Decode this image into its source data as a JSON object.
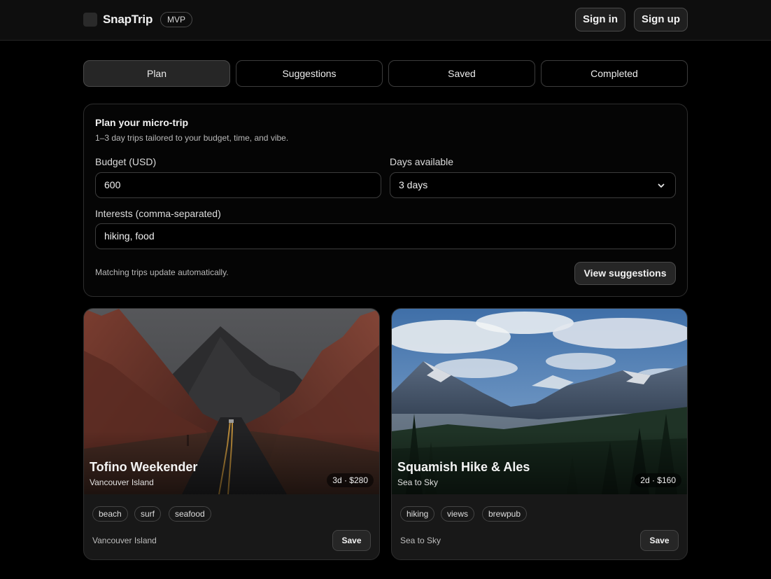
{
  "header": {
    "brand": "SnapTrip",
    "badge": "MVP",
    "signin_label": "Sign in",
    "signup_label": "Sign up",
    "logo_icon": "logo-square-icon"
  },
  "tabs": [
    {
      "label": "Plan",
      "active": true
    },
    {
      "label": "Suggestions",
      "active": false
    },
    {
      "label": "Saved",
      "active": false
    },
    {
      "label": "Completed",
      "active": false
    }
  ],
  "planner": {
    "title": "Plan your micro-trip",
    "subtitle": "1–3 day trips tailored to your budget, time, and vibe.",
    "budget_label": "Budget (USD)",
    "budget_value": "600",
    "days_label": "Days available",
    "days_value": "3 days",
    "interests_label": "Interests (comma-separated)",
    "interests_value": "hiking, food",
    "hint": "Matching trips update automatically.",
    "view_label": "View suggestions"
  },
  "trips": [
    {
      "title": "Tofino Weekender",
      "region": "Vancouver Island",
      "meta": "3d · $280",
      "tags": [
        "beach",
        "surf",
        "seafood"
      ],
      "footer": "Vancouver Island",
      "save_label": "Save"
    },
    {
      "title": "Squamish Hike & Ales",
      "region": "Sea to Sky",
      "meta": "2d · $160",
      "tags": [
        "hiking",
        "views",
        "brewpub"
      ],
      "footer": "Sea to Sky",
      "save_label": "Save"
    }
  ],
  "colors": {
    "background": "#000000",
    "header": "#0e0e0e",
    "card": "#181818",
    "border": "#2e2e2e",
    "active_tab": "#262626"
  }
}
